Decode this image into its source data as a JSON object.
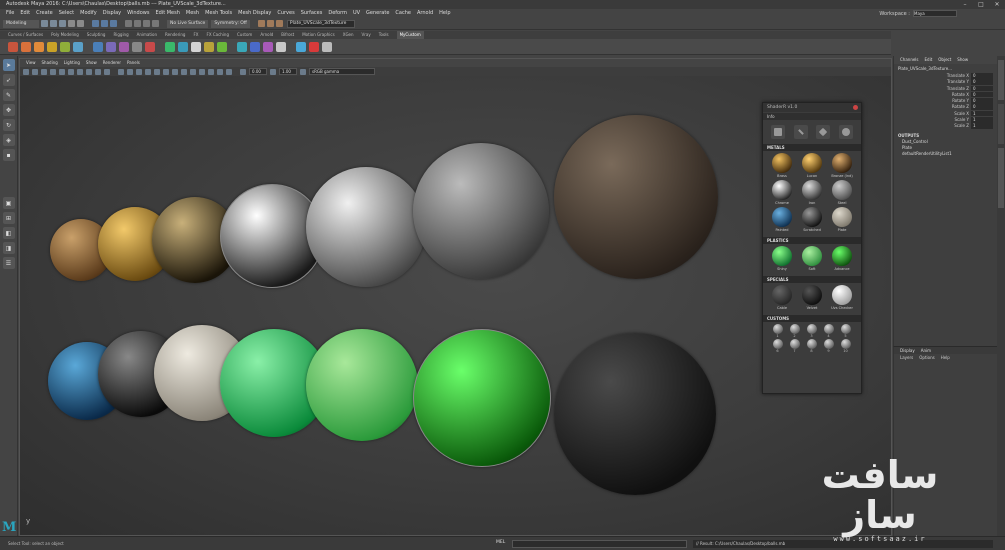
{
  "window": {
    "title": "Autodesk Maya 2016: C:\\Users\\Chaulas\\Desktop\\balls.mb  ---  Plate_UVScale_3dTexture...",
    "controls": [
      "minimize-icon",
      "maximize-icon",
      "close-icon"
    ]
  },
  "menu": {
    "items": [
      "File",
      "Edit",
      "Create",
      "Select",
      "Modify",
      "Display",
      "Windows",
      "Edit Mesh",
      "Mesh",
      "Mesh Tools",
      "Mesh Display",
      "Curves",
      "Surfaces",
      "Deform",
      "UV",
      "Generate",
      "Cache",
      "Arnold",
      "Help"
    ],
    "workspace_label": "Workspace :",
    "workspace_value": "Maya"
  },
  "status_line": {
    "mode": "Modeling",
    "live_surface": "No Live Surface",
    "symmetry": "Symmetry: Off",
    "object_field": "Plate_UVScale_3dTexture"
  },
  "shelf": {
    "tabs": [
      "Curves / Surfaces",
      "Poly Modeling",
      "Sculpting",
      "Rigging",
      "Animation",
      "Rendering",
      "FX",
      "FX Caching",
      "Custom",
      "Arnold",
      "Bifrost",
      "Motion Graphics",
      "XGen",
      "Vray",
      "Tools",
      "MyCustom"
    ],
    "active_tab": "MyCustom",
    "icon_colors": [
      "#c8553d",
      "#d9713b",
      "#e08a3a",
      "#c9a227",
      "#8fae3a",
      "#5aa0c8",
      "#4a7fb8",
      "#7a6ab8",
      "#a05aa8",
      "#888888",
      "#c84a4a",
      "#3ab86a",
      "#3a9ab8",
      "#d4d4d4",
      "#b8a23a",
      "#6ab83a",
      "#3aa8b8",
      "#4a6ac8",
      "#a85ab8",
      "#c8c8c8",
      "#4aa8d8",
      "#d83a3a",
      "#bbbbbb"
    ]
  },
  "viewport": {
    "menu": [
      "View",
      "Shading",
      "Lighting",
      "Show",
      "Renderer",
      "Panels"
    ],
    "field1": "0.00",
    "field2": "1.00",
    "colorspace": "sRGB gamma",
    "axis_label": "y"
  },
  "spheres": [
    {
      "name": "bronze-sphere",
      "row": "top",
      "c1": "#c9a06a",
      "c2": "#5a3a1a"
    },
    {
      "name": "gold-sphere",
      "row": "top",
      "c1": "#f2c96a",
      "c2": "#6a4a10"
    },
    {
      "name": "dark-gold-sphere",
      "row": "top",
      "c1": "#c8b07a",
      "c2": "#1a1408"
    },
    {
      "name": "chrome-sphere",
      "row": "top",
      "c1": "#ffffff",
      "c2": "#1a1a1a"
    },
    {
      "name": "steel-sphere",
      "row": "top",
      "c1": "#f0f0f0",
      "c2": "#4a4a4a"
    },
    {
      "name": "rough-metal-sphere",
      "row": "top",
      "c1": "#bbbbbb",
      "c2": "#3a3a3a"
    },
    {
      "name": "fabric-sphere",
      "row": "top",
      "c1": "#7a6a5a",
      "c2": "#2a221c"
    },
    {
      "name": "blue-sphere",
      "row": "bottom",
      "c1": "#5aa8d8",
      "c2": "#0a2a4a"
    },
    {
      "name": "black-sphere",
      "row": "bottom",
      "c1": "#888888",
      "c2": "#0a0a0a"
    },
    {
      "name": "marble-sphere",
      "row": "bottom",
      "c1": "#eeeae0",
      "c2": "#8a8478"
    },
    {
      "name": "green-shiny-sphere",
      "row": "bottom",
      "c1": "#8af0a8",
      "c2": "#0a8a3a"
    },
    {
      "name": "green-soft-sphere",
      "row": "bottom",
      "c1": "#a8e89a",
      "c2": "#2a9a3a"
    },
    {
      "name": "green-advance-sphere",
      "row": "bottom",
      "c1": "#6aff6a",
      "c2": "#0a5a0a"
    },
    {
      "name": "dark-fabric-sphere",
      "row": "bottom",
      "c1": "#4a4a4a",
      "c2": "#101010"
    }
  ],
  "shelf_panel": {
    "title": "ShaderR v1.0",
    "info": "Info",
    "sections": {
      "metals": "METALS",
      "plastics": "PLASTICS",
      "specials": "SPECIALS",
      "customs": "CUSTOMS"
    },
    "metals": [
      {
        "label": "Brass",
        "c1": "#f0c060",
        "c2": "#3a2408"
      },
      {
        "label": "Lucon",
        "c1": "#ffd070",
        "c2": "#4a3008"
      },
      {
        "label": "Bronze (lnd)",
        "c1": "#e0b070",
        "c2": "#2a1808"
      },
      {
        "label": "Chrome",
        "c1": "#ffffff",
        "c2": "#1a1a1a"
      },
      {
        "label": "Iron",
        "c1": "#dddddd",
        "c2": "#2a2a2a"
      },
      {
        "label": "Steel",
        "c1": "#cccccc",
        "c2": "#4a4a4a"
      },
      {
        "label": "Painted",
        "c1": "#6ab0e0",
        "c2": "#0a2a4a"
      },
      {
        "label": "Scratched",
        "c1": "#999999",
        "c2": "#0a0a0a"
      },
      {
        "label": "Plate",
        "c1": "#ddd8cc",
        "c2": "#7a7468"
      }
    ],
    "plastics": [
      {
        "label": "Shiny",
        "c1": "#8aff8a",
        "c2": "#0a6a2a"
      },
      {
        "label": "Soft",
        "c1": "#aaf0a0",
        "c2": "#2a8a3a"
      },
      {
        "label": "Advance",
        "c1": "#6aff6a",
        "c2": "#0a4a0a"
      }
    ],
    "specials": [
      {
        "label": "Cable",
        "c1": "#666666",
        "c2": "#222222"
      },
      {
        "label": "Velvet",
        "c1": "#555555",
        "c2": "#0a0a0a"
      },
      {
        "label": "Uvs Checker",
        "c1": "#ffffff",
        "c2": "#999999"
      }
    ],
    "customs": [
      "1",
      "2",
      "3",
      "4",
      "5",
      "6",
      "7",
      "8",
      "9",
      "10"
    ]
  },
  "channel_box": {
    "menu": [
      "Channels",
      "Edit",
      "Object",
      "Show"
    ],
    "object": "Plate_UVScale_3dTexture...",
    "attributes": [
      {
        "name": "Translate X",
        "value": "0"
      },
      {
        "name": "Translate Y",
        "value": "0"
      },
      {
        "name": "Translate Z",
        "value": "0"
      },
      {
        "name": "Rotate X",
        "value": "0"
      },
      {
        "name": "Rotate Y",
        "value": "0"
      },
      {
        "name": "Rotate Z",
        "value": "0"
      },
      {
        "name": "Scale X",
        "value": "1"
      },
      {
        "name": "Scale Y",
        "value": "1"
      },
      {
        "name": "Scale Z",
        "value": "1"
      }
    ],
    "outputs_header": "OUTPUTS",
    "outputs": [
      "Dust_Control",
      "Plate",
      "defaultRenderUtilityList1"
    ]
  },
  "layer_editor": {
    "tabs": [
      "Display",
      "Anim"
    ],
    "menu": [
      "Layers",
      "Options",
      "Help"
    ]
  },
  "status_bar": {
    "hint": "Select Tool: select an object",
    "mel_label": "MEL",
    "result": "// Result: C:/Users/Chaulas/Desktop/balls.mb"
  },
  "branding": {
    "maya_logo": "M",
    "watermark_text": "سافت ساز",
    "watermark_url": "www.softsaaz.ir"
  }
}
